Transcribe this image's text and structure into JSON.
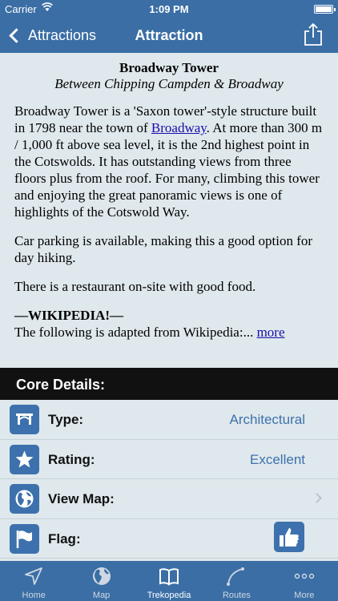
{
  "status_bar": {
    "carrier": "Carrier",
    "time": "1:09 PM"
  },
  "nav": {
    "back_label": "Attractions",
    "title": "Attraction",
    "share_icon": "share-icon"
  },
  "article": {
    "title": "Broadway Tower",
    "subtitle": "Between Chipping Campden & Broadway",
    "p1_before": "Broadway Tower is a 'Saxon tower'-style structure built in 1798 near the town of ",
    "p1_link": "Broadway",
    "p1_after": ". At more than 300 m / 1,000 ft above sea level, it is the 2nd highest point in the Cotswolds. It has outstanding views from three floors plus from the roof. For many, climbing this tower and enjoying the great panoramic views is one of highlights of the Cotswold Way.",
    "p2": "Car parking is available, making this a good option for day hiking.",
    "p3": "There is a restaurant on-site with good food.",
    "wiki_heading": "—WIKIPEDIA!—",
    "wiki_text": "The following is adapted from Wikipedia:... ",
    "wiki_more": "more"
  },
  "section": {
    "title": "Core Details:"
  },
  "details": {
    "type": {
      "label": "Type:",
      "value": "Architectural",
      "icon": "architecture-icon"
    },
    "rating": {
      "label": "Rating:",
      "value": "Excellent",
      "icon": "star-icon"
    },
    "view_map": {
      "label": "View Map:",
      "icon": "globe-icon"
    },
    "flag": {
      "label": "Flag:",
      "icon": "flag-icon",
      "action_icon": "thumbs-up-icon"
    }
  },
  "tabs": [
    {
      "label": "Home",
      "icon": "location-arrow-icon"
    },
    {
      "label": "Map",
      "icon": "globe-icon"
    },
    {
      "label": "Trekopedia",
      "icon": "book-icon"
    },
    {
      "label": "Routes",
      "icon": "route-icon"
    },
    {
      "label": "More",
      "icon": "more-icon"
    }
  ],
  "colors": {
    "bar": "#3a6ea5",
    "accent": "#3d71ad",
    "background": "#dfe8ec",
    "section": "#111111"
  }
}
